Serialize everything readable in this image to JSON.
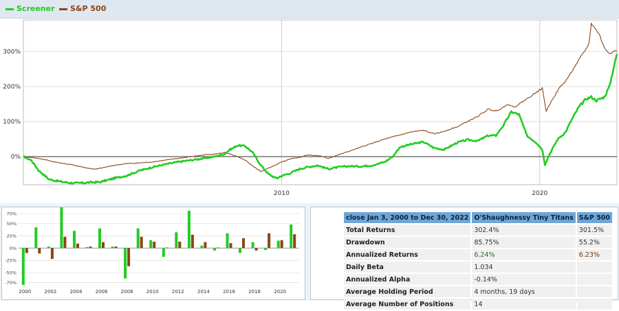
{
  "chart_data": [
    {
      "type": "line",
      "title": "",
      "xlabel": "",
      "ylabel": "",
      "x_range": [
        2000.0,
        2022.99
      ],
      "ylim": [
        -80,
        390
      ],
      "x_ticks": [
        {
          "value": 2010,
          "label": "2010"
        },
        {
          "value": 2020,
          "label": "2020"
        }
      ],
      "y_ticks": [
        {
          "value": 0,
          "label": "0%"
        },
        {
          "value": 100,
          "label": "100%"
        },
        {
          "value": 200,
          "label": "200%"
        },
        {
          "value": 300,
          "label": "300%"
        }
      ],
      "grid": true,
      "legend": "top-left",
      "series": [
        {
          "name": "Screener",
          "color": "#22cc22",
          "points": [
            [
              2000.0,
              0
            ],
            [
              2000.3,
              -10
            ],
            [
              2000.6,
              -40
            ],
            [
              2001.0,
              -65
            ],
            [
              2001.5,
              -72
            ],
            [
              2002.0,
              -76
            ],
            [
              2002.5,
              -74
            ],
            [
              2003.0,
              -72
            ],
            [
              2003.5,
              -62
            ],
            [
              2004.0,
              -54
            ],
            [
              2004.5,
              -40
            ],
            [
              2005.0,
              -30
            ],
            [
              2005.5,
              -22
            ],
            [
              2006.0,
              -15
            ],
            [
              2006.5,
              -10
            ],
            [
              2007.0,
              -5
            ],
            [
              2007.4,
              0
            ],
            [
              2007.8,
              8
            ],
            [
              2008.0,
              20
            ],
            [
              2008.3,
              32
            ],
            [
              2008.6,
              30
            ],
            [
              2008.9,
              10
            ],
            [
              2009.2,
              -25
            ],
            [
              2009.5,
              -50
            ],
            [
              2009.8,
              -62
            ],
            [
              2010.0,
              -55
            ],
            [
              2010.3,
              -48
            ],
            [
              2010.7,
              -35
            ],
            [
              2011.0,
              -30
            ],
            [
              2011.4,
              -25
            ],
            [
              2011.8,
              -35
            ],
            [
              2012.2,
              -30
            ],
            [
              2012.6,
              -27
            ],
            [
              2013.0,
              -28
            ],
            [
              2013.5,
              -25
            ],
            [
              2014.0,
              -15
            ],
            [
              2014.3,
              0
            ],
            [
              2014.6,
              28
            ],
            [
              2015.0,
              35
            ],
            [
              2015.5,
              42
            ],
            [
              2015.9,
              25
            ],
            [
              2016.3,
              20
            ],
            [
              2016.8,
              40
            ],
            [
              2017.2,
              48
            ],
            [
              2017.6,
              45
            ],
            [
              2018.0,
              60
            ],
            [
              2018.3,
              60
            ],
            [
              2018.6,
              90
            ],
            [
              2018.9,
              128
            ],
            [
              2019.2,
              120
            ],
            [
              2019.5,
              60
            ],
            [
              2019.9,
              38
            ],
            [
              2020.1,
              20
            ],
            [
              2020.2,
              -22
            ],
            [
              2020.4,
              10
            ],
            [
              2020.7,
              50
            ],
            [
              2021.0,
              70
            ],
            [
              2021.2,
              100
            ],
            [
              2021.5,
              140
            ],
            [
              2021.8,
              165
            ],
            [
              2022.0,
              170
            ],
            [
              2022.2,
              160
            ],
            [
              2022.5,
              170
            ],
            [
              2022.7,
              200
            ],
            [
              2022.85,
              250
            ],
            [
              2022.99,
              293
            ]
          ]
        },
        {
          "name": "S&P 500",
          "color": "#8b4513",
          "points": [
            [
              2000.0,
              0
            ],
            [
              2000.4,
              -3
            ],
            [
              2000.8,
              -8
            ],
            [
              2001.2,
              -15
            ],
            [
              2001.6,
              -20
            ],
            [
              2002.0,
              -25
            ],
            [
              2002.5,
              -33
            ],
            [
              2002.8,
              -36
            ],
            [
              2003.0,
              -33
            ],
            [
              2003.5,
              -25
            ],
            [
              2004.0,
              -20
            ],
            [
              2004.5,
              -18
            ],
            [
              2005.0,
              -15
            ],
            [
              2005.5,
              -10
            ],
            [
              2006.0,
              -5
            ],
            [
              2006.5,
              0
            ],
            [
              2007.0,
              5
            ],
            [
              2007.5,
              8
            ],
            [
              2007.8,
              12
            ],
            [
              2008.2,
              2
            ],
            [
              2008.6,
              -10
            ],
            [
              2008.9,
              -28
            ],
            [
              2009.2,
              -42
            ],
            [
              2009.6,
              -30
            ],
            [
              2010.0,
              -15
            ],
            [
              2010.4,
              -5
            ],
            [
              2010.7,
              -2
            ],
            [
              2011.0,
              5
            ],
            [
              2011.5,
              2
            ],
            [
              2011.8,
              -5
            ],
            [
              2012.2,
              5
            ],
            [
              2012.6,
              15
            ],
            [
              2013.0,
              25
            ],
            [
              2013.5,
              38
            ],
            [
              2014.0,
              50
            ],
            [
              2014.5,
              60
            ],
            [
              2015.0,
              70
            ],
            [
              2015.5,
              75
            ],
            [
              2015.9,
              65
            ],
            [
              2016.2,
              70
            ],
            [
              2016.8,
              85
            ],
            [
              2017.2,
              100
            ],
            [
              2017.6,
              115
            ],
            [
              2018.0,
              135
            ],
            [
              2018.3,
              130
            ],
            [
              2018.8,
              150
            ],
            [
              2019.0,
              140
            ],
            [
              2019.3,
              155
            ],
            [
              2019.7,
              175
            ],
            [
              2020.0,
              190
            ],
            [
              2020.1,
              195
            ],
            [
              2020.25,
              130
            ],
            [
              2020.5,
              165
            ],
            [
              2020.8,
              200
            ],
            [
              2021.0,
              215
            ],
            [
              2021.3,
              250
            ],
            [
              2021.6,
              285
            ],
            [
              2021.9,
              320
            ],
            [
              2022.0,
              380
            ],
            [
              2022.3,
              350
            ],
            [
              2022.5,
              310
            ],
            [
              2022.7,
              295
            ],
            [
              2022.85,
              300
            ],
            [
              2022.99,
              302
            ]
          ]
        }
      ]
    },
    {
      "type": "bar",
      "title": "",
      "xlabel": "",
      "ylabel": "",
      "ylim": [
        -75,
        80
      ],
      "y_ticks": [
        {
          "value": 70,
          "label": "70%"
        },
        {
          "value": 50,
          "label": "50%"
        },
        {
          "value": 25,
          "label": "25%"
        },
        {
          "value": 0,
          "label": "0%"
        },
        {
          "value": -25,
          "label": "-25%"
        },
        {
          "value": -50,
          "label": "-50%"
        },
        {
          "value": -70,
          "label": "-70%"
        }
      ],
      "x_tick_labels": [
        "2000",
        "2002",
        "2004",
        "2006",
        "2008",
        "2010",
        "2012",
        "2014",
        "2016",
        "2018",
        "2020"
      ],
      "categories": [
        "2000",
        "2001",
        "2002",
        "2003",
        "2004",
        "2005",
        "2006",
        "2007",
        "2008",
        "2009",
        "2010",
        "2011",
        "2012",
        "2013",
        "2014",
        "2015",
        "2016",
        "2017",
        "2018",
        "2019",
        "2020",
        "2021"
      ],
      "series": [
        {
          "name": "Screener",
          "color": "#22cc22",
          "values": [
            -75,
            42,
            3,
            92,
            35,
            2,
            40,
            3,
            -62,
            40,
            16,
            -18,
            32,
            76,
            5,
            -5,
            30,
            -10,
            12,
            -4,
            15,
            48
          ]
        },
        {
          "name": "S&P 500",
          "color": "#8b4513",
          "values": [
            -10,
            -11,
            -22,
            23,
            9,
            3,
            12,
            3,
            -37,
            23,
            13,
            1,
            13,
            27,
            12,
            1,
            10,
            20,
            -5,
            30,
            16,
            28
          ]
        }
      ]
    }
  ],
  "legend": {
    "screener_label": "Screener",
    "sp500_label": "S&P 500"
  },
  "stats_table": {
    "headers": [
      "close Jan 3, 2000 to Dec 30, 2022",
      "O'Shaughnessy Tiny Titans",
      "S&P 500"
    ],
    "rows": [
      {
        "label": "Total Returns",
        "screener": "302.4%",
        "sp500": "301.5%",
        "style": "plain"
      },
      {
        "label": "Drawdown",
        "screener": "85.75%",
        "sp500": "55.2%",
        "style": "plain"
      },
      {
        "label": "Annualized Returns",
        "screener": "6.24%",
        "sp500": "6.23%",
        "style": "color"
      },
      {
        "label": "Daily Beta",
        "screener": "1.034",
        "sp500": "",
        "style": "plain"
      },
      {
        "label": "Annualized Alpha",
        "screener": "-0.14%",
        "sp500": "",
        "style": "plain"
      },
      {
        "label": "Average Holding Period",
        "screener": "4 months, 19 days",
        "sp500": "",
        "style": "plain"
      },
      {
        "label": "Average Number of Positions",
        "screener": "14",
        "sp500": "",
        "style": "plain"
      }
    ]
  }
}
